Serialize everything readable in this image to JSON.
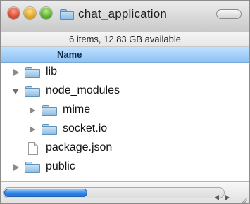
{
  "window": {
    "title": "chat_application",
    "status": "6 items, 12.83 GB available"
  },
  "columns": {
    "name": "Name"
  },
  "items": [
    {
      "label": "lib",
      "kind": "folder",
      "expanded": false,
      "indent": 0
    },
    {
      "label": "node_modules",
      "kind": "folder",
      "expanded": true,
      "indent": 0
    },
    {
      "label": "mime",
      "kind": "folder",
      "expanded": false,
      "indent": 1
    },
    {
      "label": "socket.io",
      "kind": "folder",
      "expanded": false,
      "indent": 1
    },
    {
      "label": "package.json",
      "kind": "file",
      "indent": 0
    },
    {
      "label": "public",
      "kind": "folder",
      "expanded": false,
      "indent": 0
    }
  ],
  "colors": {
    "header_blue": "#9ccbf7",
    "folder_blue": "#8dbbe0",
    "scroll_thumb_blue": "#2f84e8"
  },
  "icons": {
    "window_title": "folder-icon",
    "folder": "folder-icon",
    "file": "document-icon",
    "collapsed": "disclosure-right-icon",
    "expanded": "disclosure-down-icon"
  }
}
